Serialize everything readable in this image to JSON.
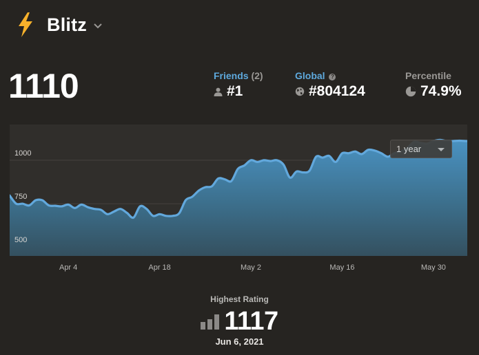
{
  "header": {
    "title": "Blitz"
  },
  "rating": "1110",
  "stats": {
    "friends": {
      "label": "Friends",
      "count": "(2)",
      "value": "#1"
    },
    "global": {
      "label": "Global",
      "help": "?",
      "value": "#804124"
    },
    "percentile": {
      "label": "Percentile",
      "value": "74.9%"
    }
  },
  "range_select": {
    "value": "1 year"
  },
  "highest": {
    "label": "Highest Rating",
    "value": "1117",
    "date": "Jun 6, 2021"
  },
  "colors": {
    "accent": "#5ea9dd",
    "line": "#62a8dc",
    "background": "#262421",
    "panel": "#302e2b",
    "bolt": "#f7b12b"
  },
  "chart_data": {
    "type": "area",
    "yticks": [
      500,
      750,
      1000
    ],
    "ylim": [
      450,
      1205
    ],
    "xticks": [
      "Apr 4",
      "Apr 18",
      "May 2",
      "May 16",
      "May 30"
    ],
    "x": [
      "2021-03-26",
      "2021-03-27",
      "2021-03-28",
      "2021-03-29",
      "2021-03-30",
      "2021-03-31",
      "2021-04-01",
      "2021-04-02",
      "2021-04-03",
      "2021-04-04",
      "2021-04-05",
      "2021-04-06",
      "2021-04-07",
      "2021-04-08",
      "2021-04-09",
      "2021-04-10",
      "2021-04-11",
      "2021-04-12",
      "2021-04-13",
      "2021-04-14",
      "2021-04-15",
      "2021-04-16",
      "2021-04-17",
      "2021-04-18",
      "2021-04-19",
      "2021-04-20",
      "2021-04-21",
      "2021-04-22",
      "2021-04-23",
      "2021-04-24",
      "2021-04-25",
      "2021-04-26",
      "2021-04-27",
      "2021-04-28",
      "2021-04-29",
      "2021-04-30",
      "2021-05-01",
      "2021-05-02",
      "2021-05-03",
      "2021-05-04",
      "2021-05-05",
      "2021-05-06",
      "2021-05-07",
      "2021-05-08",
      "2021-05-09",
      "2021-05-10",
      "2021-05-11",
      "2021-05-12",
      "2021-05-13",
      "2021-05-14",
      "2021-05-15",
      "2021-05-16",
      "2021-05-17",
      "2021-05-18",
      "2021-05-19",
      "2021-05-20",
      "2021-05-21",
      "2021-05-22",
      "2021-05-23",
      "2021-05-24",
      "2021-05-25",
      "2021-05-26",
      "2021-05-27",
      "2021-05-28",
      "2021-05-29",
      "2021-05-30",
      "2021-05-31",
      "2021-06-01",
      "2021-06-02",
      "2021-06-03",
      "2021-06-04",
      "2021-06-05",
      "2021-06-06",
      "2021-06-07"
    ],
    "series": [
      {
        "values": [
          797,
          750,
          750,
          740,
          770,
          770,
          740,
          738,
          735,
          745,
          725,
          745,
          730,
          720,
          715,
          690,
          705,
          720,
          697,
          670,
          735,
          720,
          680,
          690,
          680,
          680,
          695,
          770,
          790,
          825,
          845,
          850,
          895,
          890,
          880,
          950,
          970,
          1000,
          990,
          1000,
          995,
          1000,
          975,
          900,
          935,
          930,
          940,
          1020,
          1015,
          1025,
          990,
          1040,
          1040,
          1050,
          1035,
          1060,
          1055,
          1040,
          1020,
          1040,
          1050,
          1070,
          1105,
          1100,
          1095,
          1110,
          1117,
          1110,
          1110,
          1112,
          1110,
          1112,
          1117,
          1110
        ]
      }
    ]
  }
}
